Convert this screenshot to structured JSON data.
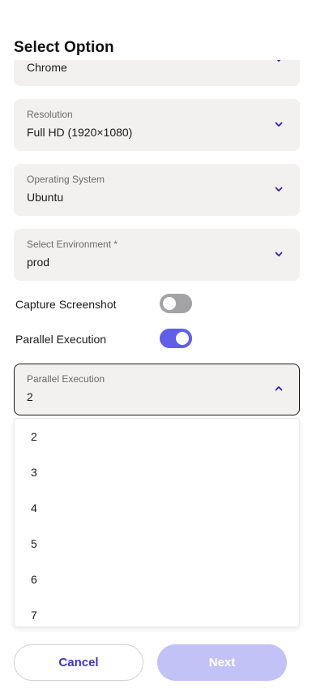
{
  "dialog": {
    "title": "Select Option"
  },
  "fields": {
    "browser": {
      "label": "",
      "value": "Chrome"
    },
    "resolution": {
      "label": "Resolution",
      "value": "Full HD (1920×1080)"
    },
    "os": {
      "label": "Operating System",
      "value": "Ubuntu"
    },
    "environment": {
      "label": "Select Environment *",
      "value": "prod"
    },
    "parallel": {
      "label": "Parallel Execution",
      "value": "2"
    }
  },
  "toggles": {
    "capture_screenshot": {
      "label": "Capture Screenshot",
      "enabled": false
    },
    "parallel_execution": {
      "label": "Parallel Execution",
      "enabled": true
    }
  },
  "dropdown": {
    "options": [
      "2",
      "3",
      "4",
      "5",
      "6",
      "7"
    ]
  },
  "buttons": {
    "cancel": "Cancel",
    "next": "Next"
  },
  "colors": {
    "accent": "#5f5fe8",
    "chevron": "#3b1fa8",
    "button_text": "#3b36c4",
    "next_disabled": "#c3c2f6"
  },
  "icons": {
    "close": "close-icon",
    "chevron_down": "chevron-down-icon",
    "chevron_up": "chevron-up-icon"
  }
}
